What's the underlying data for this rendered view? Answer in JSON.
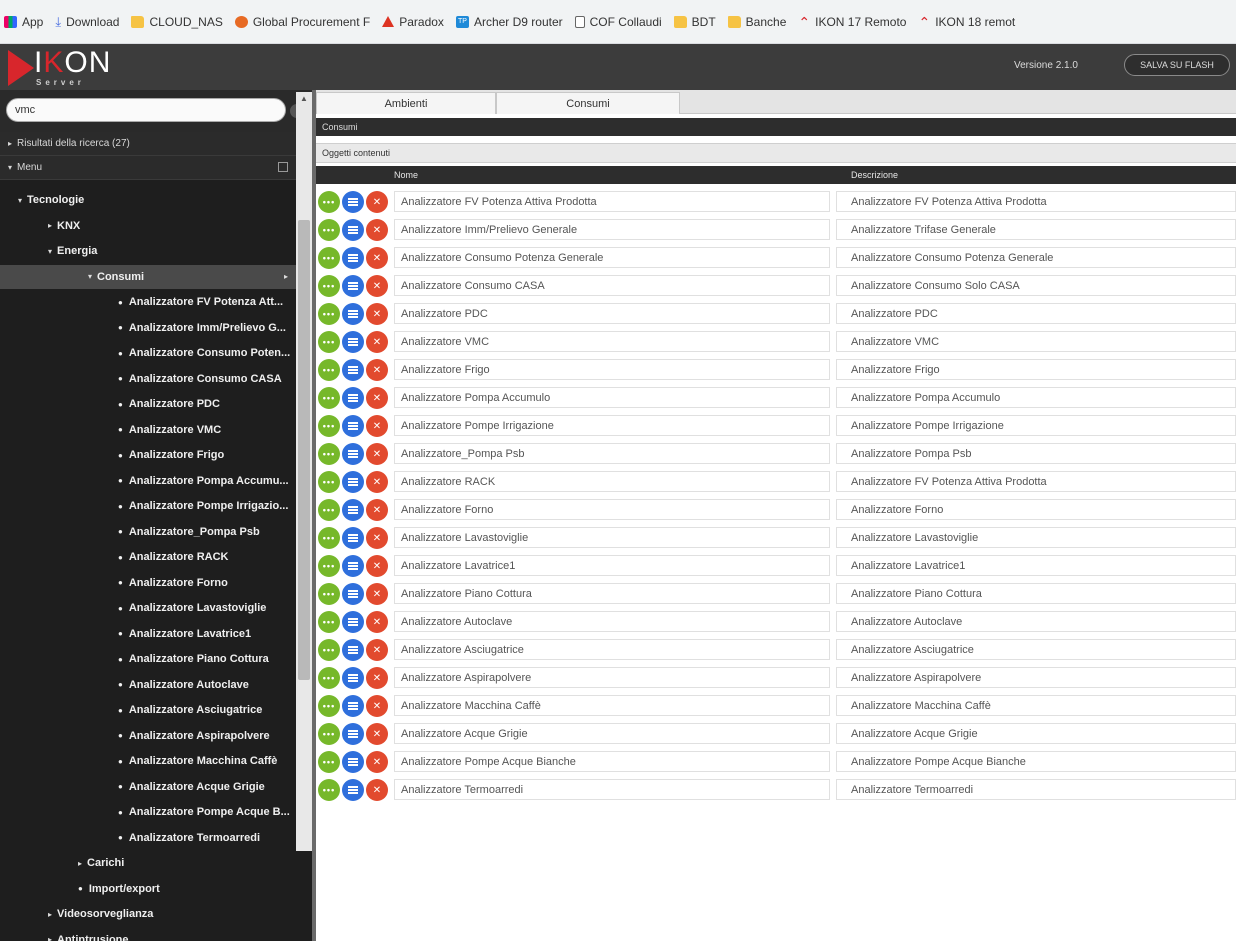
{
  "bookmarks": [
    {
      "label": "App",
      "icon": "apps-icon"
    },
    {
      "label": "Download",
      "icon": "download-icon"
    },
    {
      "label": "CLOUD_NAS",
      "icon": "folder-icon"
    },
    {
      "label": "Global Procurement F",
      "icon": "globe-icon"
    },
    {
      "label": "Paradox",
      "icon": "paradox-icon"
    },
    {
      "label": "Archer D9 router",
      "icon": "router-icon"
    },
    {
      "label": "COF Collaudi",
      "icon": "page-icon"
    },
    {
      "label": "BDT",
      "icon": "folder-icon"
    },
    {
      "label": "Banche",
      "icon": "folder-icon"
    },
    {
      "label": "IKON 17 Remoto",
      "icon": "ikon-icon"
    },
    {
      "label": "IKON 18 remot",
      "icon": "ikon-icon"
    }
  ],
  "header": {
    "logo_pre": "I",
    "logo_k": "K",
    "logo_post": "ON",
    "logo_sub": "Server",
    "version": "Versione 2.1.0",
    "flash_button": "SALVA SU FLASH"
  },
  "sidebar": {
    "search_value": "vmc",
    "results_label": "Risultati della ricerca (27)",
    "menu_label": "Menu",
    "tree": [
      {
        "label": "Tecnologie",
        "marker": "▾",
        "indent": 18,
        "type": "open"
      },
      {
        "label": "KNX",
        "marker": "▸",
        "indent": 48,
        "type": "closed"
      },
      {
        "label": "Energia",
        "marker": "▾",
        "indent": 48,
        "type": "open"
      },
      {
        "label": "Consumi",
        "marker": "▾",
        "indent": 88,
        "type": "active"
      },
      {
        "label": "Analizzatore FV Potenza Att...",
        "marker": "●",
        "indent": 118,
        "type": "leaf"
      },
      {
        "label": "Analizzatore Imm/Prelievo G...",
        "marker": "●",
        "indent": 118,
        "type": "leaf"
      },
      {
        "label": "Analizzatore Consumo Poten...",
        "marker": "●",
        "indent": 118,
        "type": "leaf"
      },
      {
        "label": "Analizzatore Consumo CASA",
        "marker": "●",
        "indent": 118,
        "type": "leaf"
      },
      {
        "label": "Analizzatore PDC",
        "marker": "●",
        "indent": 118,
        "type": "leaf"
      },
      {
        "label": "Analizzatore VMC",
        "marker": "●",
        "indent": 118,
        "type": "leaf"
      },
      {
        "label": "Analizzatore Frigo",
        "marker": "●",
        "indent": 118,
        "type": "leaf"
      },
      {
        "label": "Analizzatore Pompa Accumu...",
        "marker": "●",
        "indent": 118,
        "type": "leaf"
      },
      {
        "label": "Analizzatore Pompe Irrigazio...",
        "marker": "●",
        "indent": 118,
        "type": "leaf"
      },
      {
        "label": "Analizzatore_Pompa Psb",
        "marker": "●",
        "indent": 118,
        "type": "leaf"
      },
      {
        "label": "Analizzatore RACK",
        "marker": "●",
        "indent": 118,
        "type": "leaf"
      },
      {
        "label": "Analizzatore Forno",
        "marker": "●",
        "indent": 118,
        "type": "leaf"
      },
      {
        "label": "Analizzatore Lavastoviglie",
        "marker": "●",
        "indent": 118,
        "type": "leaf"
      },
      {
        "label": "Analizzatore Lavatrice1",
        "marker": "●",
        "indent": 118,
        "type": "leaf"
      },
      {
        "label": "Analizzatore Piano Cottura",
        "marker": "●",
        "indent": 118,
        "type": "leaf"
      },
      {
        "label": "Analizzatore Autoclave",
        "marker": "●",
        "indent": 118,
        "type": "leaf"
      },
      {
        "label": "Analizzatore Asciugatrice",
        "marker": "●",
        "indent": 118,
        "type": "leaf"
      },
      {
        "label": "Analizzatore Aspirapolvere",
        "marker": "●",
        "indent": 118,
        "type": "leaf"
      },
      {
        "label": "Analizzatore Macchina Caffè",
        "marker": "●",
        "indent": 118,
        "type": "leaf"
      },
      {
        "label": "Analizzatore Acque Grigie",
        "marker": "●",
        "indent": 118,
        "type": "leaf"
      },
      {
        "label": "Analizzatore Pompe Acque B...",
        "marker": "●",
        "indent": 118,
        "type": "leaf"
      },
      {
        "label": "Analizzatore Termoarredi",
        "marker": "●",
        "indent": 118,
        "type": "leaf"
      },
      {
        "label": "Carichi",
        "marker": "▸",
        "indent": 78,
        "type": "closed"
      },
      {
        "label": "Import/export",
        "marker": "●",
        "indent": 78,
        "type": "leaf"
      },
      {
        "label": "Videosorveglianza",
        "marker": "▸",
        "indent": 48,
        "type": "closed"
      },
      {
        "label": "Antintrusione",
        "marker": "▸",
        "indent": 48,
        "type": "closed"
      }
    ]
  },
  "main": {
    "tabs": [
      "Ambienti",
      "Consumi"
    ],
    "section_title": "Consumi",
    "subsection_title": "Oggetti contenuti",
    "columns": {
      "name": "Nome",
      "description": "Descrizione"
    },
    "rows": [
      {
        "name": "Analizzatore FV Potenza Attiva Prodotta",
        "description": "Analizzatore FV Potenza Attiva Prodotta"
      },
      {
        "name": "Analizzatore Imm/Prelievo Generale",
        "description": "Analizzatore Trifase Generale"
      },
      {
        "name": "Analizzatore Consumo Potenza Generale",
        "description": "Analizzatore Consumo Potenza Generale"
      },
      {
        "name": "Analizzatore Consumo CASA",
        "description": "Analizzatore Consumo Solo CASA"
      },
      {
        "name": "Analizzatore PDC",
        "description": "Analizzatore PDC"
      },
      {
        "name": "Analizzatore VMC",
        "description": "Analizzatore VMC"
      },
      {
        "name": "Analizzatore Frigo",
        "description": "Analizzatore Frigo"
      },
      {
        "name": "Analizzatore Pompa Accumulo",
        "description": "Analizzatore Pompa Accumulo"
      },
      {
        "name": "Analizzatore Pompe Irrigazione",
        "description": "Analizzatore Pompe Irrigazione"
      },
      {
        "name": "Analizzatore_Pompa Psb",
        "description": "Analizzatore Pompa Psb"
      },
      {
        "name": "Analizzatore RACK",
        "description": "Analizzatore FV Potenza Attiva Prodotta"
      },
      {
        "name": "Analizzatore Forno",
        "description": "Analizzatore Forno"
      },
      {
        "name": "Analizzatore Lavastoviglie",
        "description": "Analizzatore Lavastoviglie"
      },
      {
        "name": "Analizzatore Lavatrice1",
        "description": "Analizzatore Lavatrice1"
      },
      {
        "name": "Analizzatore Piano Cottura",
        "description": "Analizzatore Piano Cottura"
      },
      {
        "name": "Analizzatore Autoclave",
        "description": "Analizzatore Autoclave"
      },
      {
        "name": "Analizzatore Asciugatrice",
        "description": "Analizzatore Asciugatrice"
      },
      {
        "name": "Analizzatore Aspirapolvere",
        "description": "Analizzatore Aspirapolvere"
      },
      {
        "name": "Analizzatore Macchina Caffè",
        "description": "Analizzatore Macchina Caffè"
      },
      {
        "name": "Analizzatore Acque Grigie",
        "description": "Analizzatore Acque Grigie"
      },
      {
        "name": "Analizzatore Pompe Acque Bianche",
        "description": "Analizzatore Pompe Acque Bianche"
      },
      {
        "name": "Analizzatore Termoarredi",
        "description": "Analizzatore Termoarredi"
      }
    ]
  },
  "colors": {
    "accent_red": "#d8262c",
    "action_green": "#76b82a",
    "action_blue": "#2f6fdc",
    "action_red": "#e24a2e",
    "sidebar_bg": "#1e1e1e",
    "header_bg": "#3c3c3c"
  }
}
